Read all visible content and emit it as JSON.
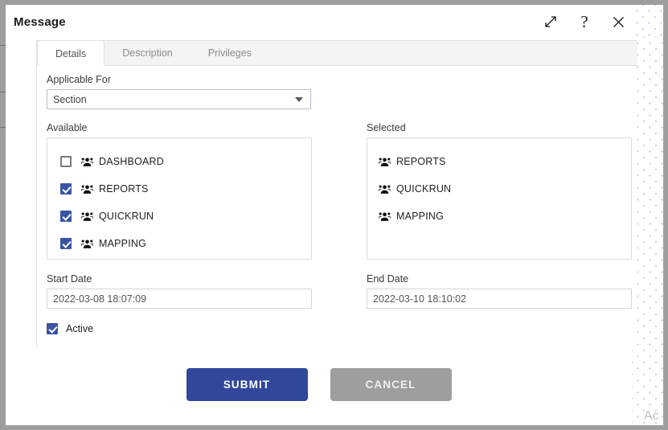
{
  "window": {
    "title": "Message",
    "controls": [
      {
        "name": "expand-icon",
        "label": "Expand"
      },
      {
        "name": "help-icon",
        "label": "?"
      },
      {
        "name": "close-icon",
        "label": "Close"
      }
    ]
  },
  "tabs": [
    {
      "label": "Details",
      "active": true
    },
    {
      "label": "Description",
      "active": false
    },
    {
      "label": "Privileges",
      "active": false
    }
  ],
  "form": {
    "applicable_for": {
      "label": "Applicable For",
      "value": "Section",
      "options": [
        "Section"
      ]
    },
    "available": {
      "label": "Available",
      "items": [
        {
          "label": "DASHBOARD",
          "checked": false
        },
        {
          "label": "REPORTS",
          "checked": true
        },
        {
          "label": "QUICKRUN",
          "checked": true
        },
        {
          "label": "MAPPING",
          "checked": true
        }
      ]
    },
    "selected": {
      "label": "Selected",
      "items": [
        {
          "label": "REPORTS"
        },
        {
          "label": "QUICKRUN"
        },
        {
          "label": "MAPPING"
        }
      ]
    },
    "start_date": {
      "label": "Start Date",
      "value": "2022-03-08 18:07:09"
    },
    "end_date": {
      "label": "End Date",
      "value": "2022-03-10 18:10:02"
    },
    "active": {
      "label": "Active",
      "checked": true
    }
  },
  "footer": {
    "submit_label": "SUBMIT",
    "cancel_label": "CANCEL"
  },
  "watermark": {
    "text": "Ac"
  },
  "colors": {
    "primary": "#31479b",
    "checkbox": "#3954a5",
    "cancel": "#9e9e9e",
    "chrome": "#9e9e9e",
    "dot_pattern": "#b9bde4"
  }
}
